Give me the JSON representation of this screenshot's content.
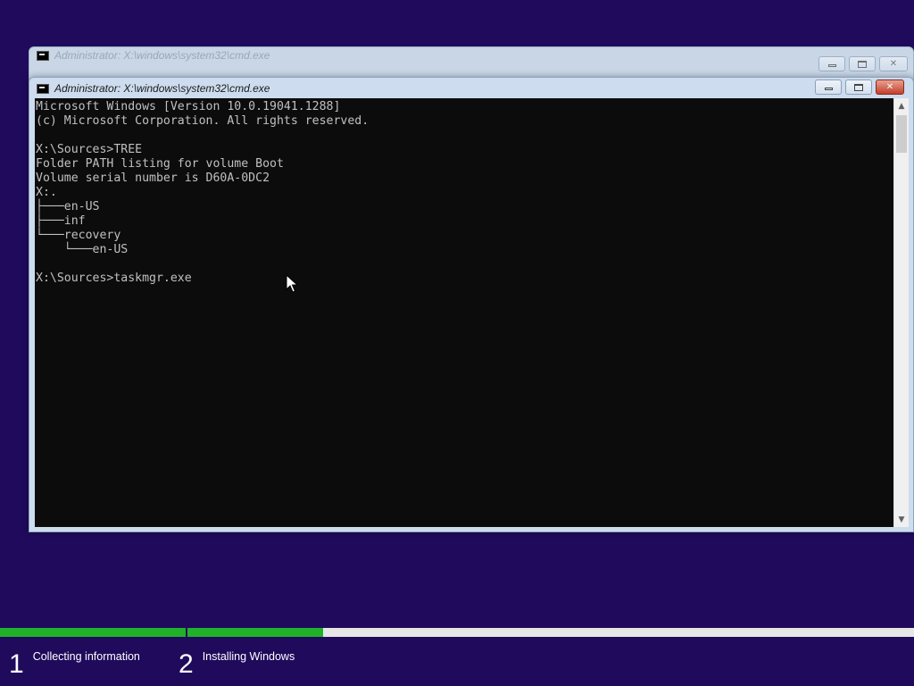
{
  "back_window": {
    "title": "Administrator: X:\\windows\\system32\\cmd.exe"
  },
  "front_window": {
    "title": "Administrator: X:\\windows\\system32\\cmd.exe"
  },
  "console": {
    "lines": [
      "Microsoft Windows [Version 10.0.19041.1288]",
      "(c) Microsoft Corporation. All rights reserved.",
      "",
      "X:\\Sources>TREE",
      "Folder PATH listing for volume Boot",
      "Volume serial number is D60A-0DC2",
      "X:.",
      "├───en-US",
      "├───inf",
      "└───recovery",
      "    └───en-US",
      "",
      "X:\\Sources>taskmgr.exe"
    ]
  },
  "icons": {
    "app": "cmd-icon",
    "minimize": "minimize-icon",
    "maximize": "maximize-icon",
    "close": "close-icon",
    "scroll_up": "chevron-up-icon",
    "scroll_down": "chevron-down-icon",
    "cursor": "mouse-pointer-icon"
  },
  "setup_progress": {
    "steps": [
      {
        "number": "1",
        "label": "Collecting information",
        "progress": 1.0
      },
      {
        "number": "2",
        "label": "Installing Windows",
        "progress": 0.187
      }
    ],
    "colors": {
      "fill": "#22b12a",
      "track": "#e6e6e6",
      "background": "#1f0a5c"
    }
  }
}
